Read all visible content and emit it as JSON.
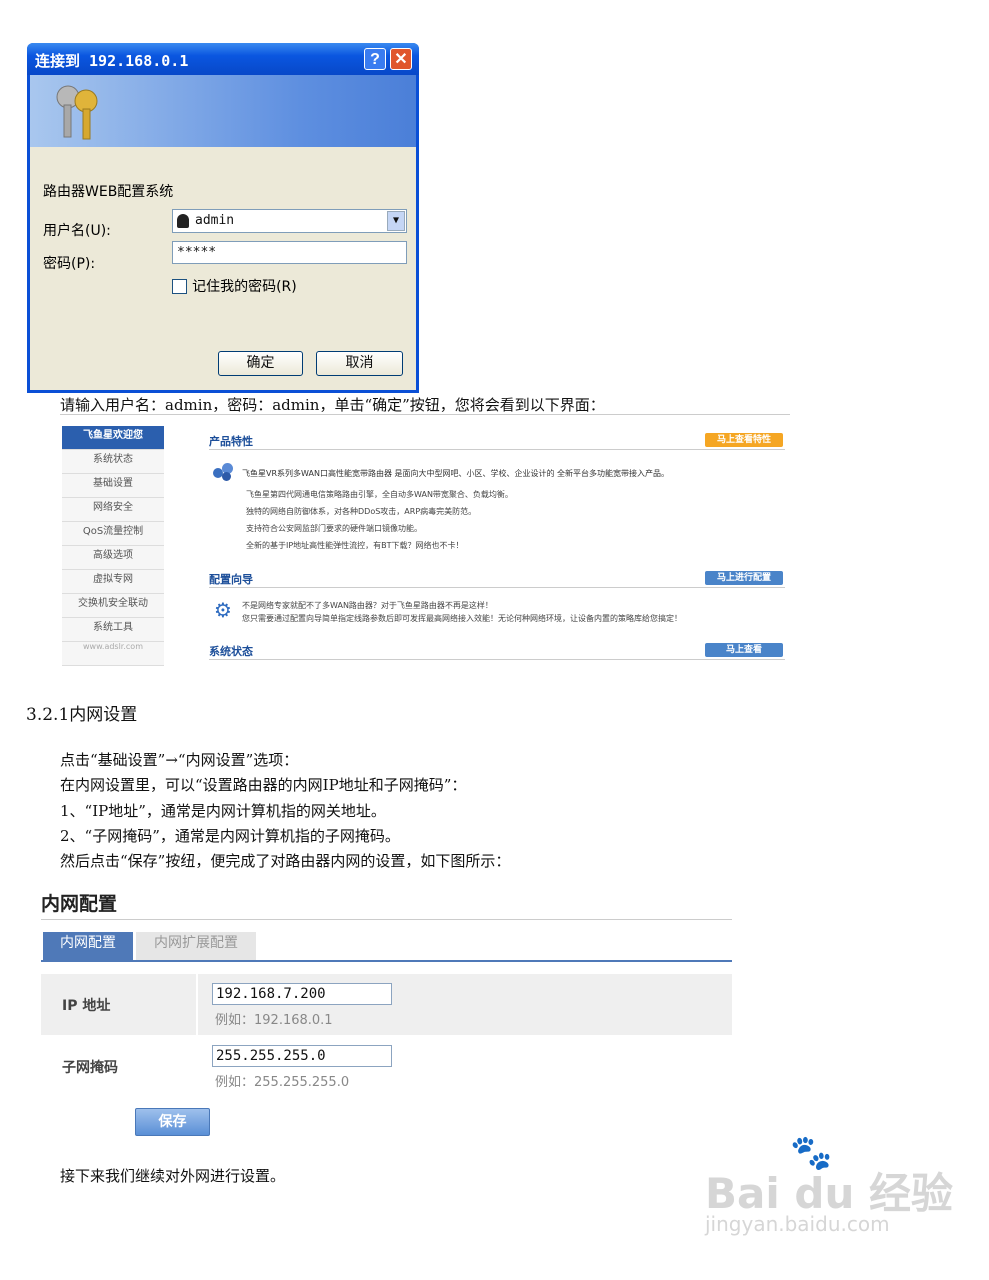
{
  "dialog": {
    "title": "连接到 192.168.0.1",
    "help_label": "?",
    "close_label": "✕",
    "system_name": "路由器WEB配置系统",
    "username_label": "用户名(U):",
    "password_label": "密码(P):",
    "username_value": "admin",
    "password_value": "*****",
    "remember_label": "记住我的密码(R)",
    "ok_label": "确定",
    "cancel_label": "取消"
  },
  "intro_text": "请输入用户名：admin，密码：admin，单击“确定”按钮，您将会看到以下界面：",
  "router_panel": {
    "sidebar": [
      "飞鱼星欢迎您",
      "系统状态",
      "基础设置",
      "网络安全",
      "QoS流量控制",
      "高级选项",
      "虚拟专网",
      "交换机安全联动",
      "系统工具"
    ],
    "footer": "www.adslr.com",
    "features_title": "产品特性",
    "features_button": "马上查看特性",
    "features_headline": "飞鱼星VR系列多WAN口高性能宽带路由器 是面向大中型网吧、小区、学校、企业设计的 全新平台多功能宽带接入产品。",
    "features_lines": [
      "飞鱼星第四代网通电信策略路由引擎，全自动多WAN带宽聚合、负载均衡。",
      "独特的网络自防御体系，对各种DDoS攻击，ARP病毒完美防范。",
      "支持符合公安网监部门要求的硬件端口镜像功能。",
      "全新的基于IP地址高性能弹性流控，有BT下载？网络也不卡！"
    ],
    "wizard_title": "配置向导",
    "wizard_button": "马上进行配置",
    "wizard_lines": [
      "不是网络专家就配不了多WAN路由器？对于飞鱼星路由器不再是这样！",
      "您只需要通过配置向导简单指定线路参数后即可发挥最高网络接入效能！无论何种网络环境，让设备内置的策略库给您搞定！"
    ],
    "status_title": "系统状态",
    "status_button": "马上查看"
  },
  "section_heading": "3.2.1内网设置",
  "instructions": [
    "点击“基础设置”→“内网设置”选项：",
    "在内网设置里，可以“设置路由器的内网IP地址和子网掩码”：",
    "1、“IP地址”，通常是内网计算机指的网关地址。",
    "2、“子网掩码”，通常是内网计算机指的子网掩码。",
    "然后点击“保存”按纽，便完成了对路由器内网的设置，如下图所示："
  ],
  "lan_config": {
    "title": "内网配置",
    "tab_active": "内网配置",
    "tab_inactive": "内网扩展配置",
    "ip_label": "IP 地址",
    "ip_value": "192.168.7.200",
    "ip_hint": "例如：192.168.0.1",
    "mask_label": "子网掩码",
    "mask_value": "255.255.255.0",
    "mask_hint": "例如：255.255.255.0",
    "save_label": "保存"
  },
  "closing_text": "接下来我们继续对外网进行设置。",
  "watermark": {
    "brand": "Bai du 经验",
    "url": "jingyan.baidu.com"
  },
  "colors": {
    "xp_blue": "#0a4fd6",
    "xp_face": "#ece9d8",
    "panel_blue": "#2b5fae",
    "orange": "#f5a623"
  }
}
